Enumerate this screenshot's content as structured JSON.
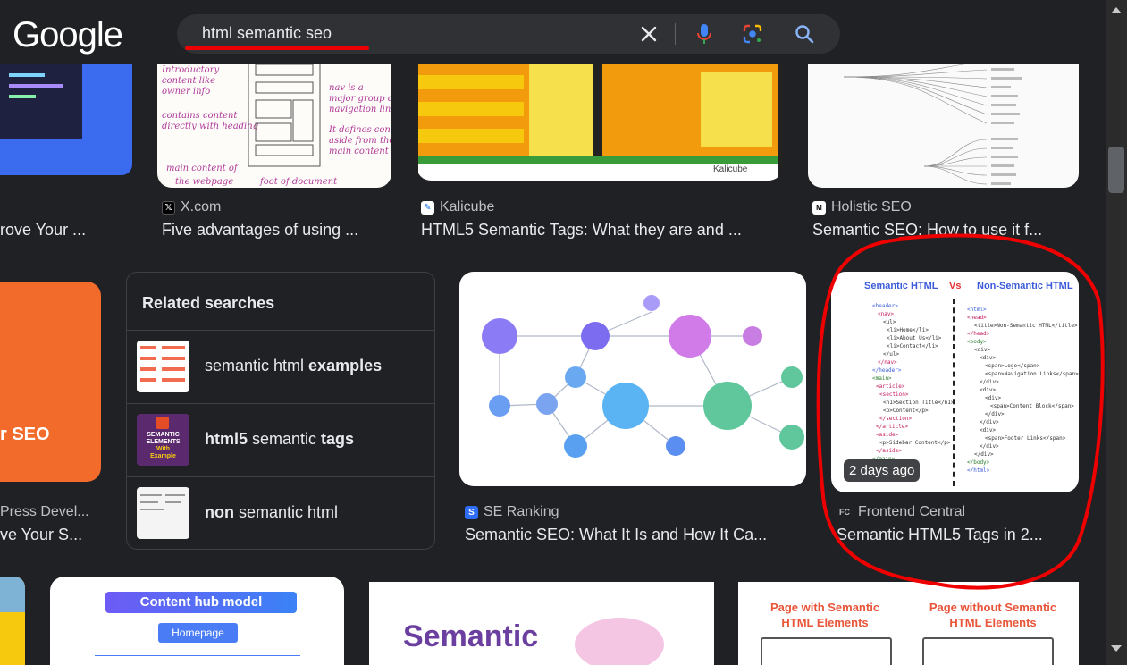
{
  "header": {
    "logo": "Google",
    "search_query": "html semantic seo"
  },
  "icons": {
    "clear": "close-icon",
    "voice": "microphone-icon",
    "lens": "google-lens-icon",
    "search": "search-icon"
  },
  "row1": [
    {
      "source": "",
      "title": "rove Your ..."
    },
    {
      "source": "X.com",
      "title": "Five advantages of using ..."
    },
    {
      "source": "Kalicube",
      "title": "HTML5 Semantic Tags: What they are and ..."
    },
    {
      "source": "Holistic SEO",
      "title": "Semantic SEO: How to use it f..."
    }
  ],
  "row2": [
    {
      "source": "Press Devel...",
      "title": "ve Your S..."
    },
    {
      "source": "SE Ranking",
      "title": "Semantic SEO: What It Is and How It Ca..."
    },
    {
      "source": "Frontend Central",
      "title": "Semantic HTML5 Tags in 2..."
    }
  ],
  "left_card_text": "r SEO",
  "related": {
    "title": "Related searches",
    "items": [
      {
        "pre": "semantic html ",
        "bold": "examples",
        "post": ""
      },
      {
        "pre": "",
        "bold": "html5",
        "post": " semantic ",
        "bold2": "tags"
      },
      {
        "pre": "",
        "bold": "non",
        "post": " semantic html"
      }
    ]
  },
  "badge": "2 days ago",
  "thumb_texts": {
    "kalicube": "Kalicube",
    "frontend_left": "Semantic HTML",
    "frontend_vs": "Vs",
    "frontend_right": "Non-Semantic HTML",
    "content_hub": "Content hub model",
    "homepage": "Homepage",
    "semantic": "Semantic",
    "page_with": "Page with Semantic HTML Elements",
    "page_without": "Page without Semantic HTML Elements",
    "rel2_line1": "SEMANTIC",
    "rel2_line2": "ELEMENTS",
    "rel2_line3": "With",
    "rel2_line4": "Example"
  },
  "colors": {
    "background": "#202124",
    "annotation_red": "#ee0000",
    "seo_orange": "#f26b2a"
  }
}
